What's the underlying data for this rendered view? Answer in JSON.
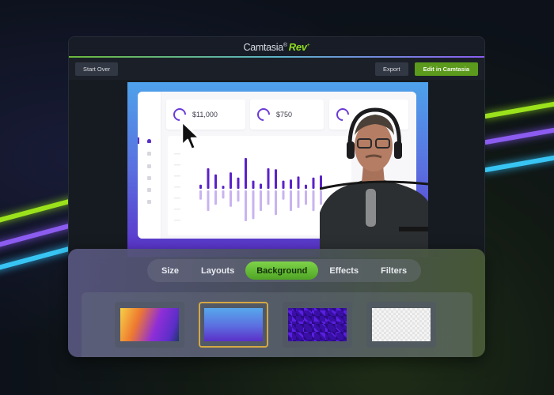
{
  "app": {
    "logo_text": "Camtasia",
    "logo_accent": "Rev",
    "logo_mark": "+"
  },
  "toolbar": {
    "start_over_label": "Start Over",
    "export_label": "Export",
    "edit_in_camtasia_label": "Edit in Camtasia"
  },
  "preview": {
    "dashboard": {
      "stats": [
        {
          "value": "$11,000",
          "icon": "ring-progress-icon"
        },
        {
          "value": "$750",
          "icon": "ring-progress-icon"
        },
        {
          "value": "",
          "icon": "ring-progress-icon"
        }
      ],
      "sidebar_icons": [
        "home-icon",
        "grid-icon",
        "chat-icon",
        "folder-icon",
        "calendar-icon",
        "settings-icon"
      ],
      "chart": {
        "upper_bars": [
          4,
          20,
          14,
          3,
          16,
          11,
          30,
          8,
          5,
          20,
          19,
          8,
          9,
          12,
          4,
          11,
          13
        ],
        "lower_bars": [
          9,
          20,
          14,
          8,
          16,
          11,
          30,
          28,
          20,
          14,
          24,
          9,
          20,
          17,
          14,
          20,
          14
        ],
        "colors": {
          "upper": "#5b22c8",
          "lower": "#c8b4ef"
        }
      }
    },
    "webcam_label": "presenter-webcam"
  },
  "panel": {
    "tabs": [
      {
        "label": "Size",
        "active": false
      },
      {
        "label": "Layouts",
        "active": false
      },
      {
        "label": "Background",
        "active": true
      },
      {
        "label": "Effects",
        "active": false
      },
      {
        "label": "Filters",
        "active": false
      }
    ],
    "backgrounds": [
      {
        "name": "sunset-gradient",
        "selected": false
      },
      {
        "name": "blue-purple-gradient",
        "selected": true
      },
      {
        "name": "purple-pixel-pattern",
        "selected": false
      },
      {
        "name": "transparent",
        "selected": false
      }
    ]
  },
  "colors": {
    "accent_green": "#5b9a1c",
    "brand_rev": "#8fdc1e",
    "selection_outline": "#d4a843",
    "chart_purple": "#5b22c8"
  }
}
